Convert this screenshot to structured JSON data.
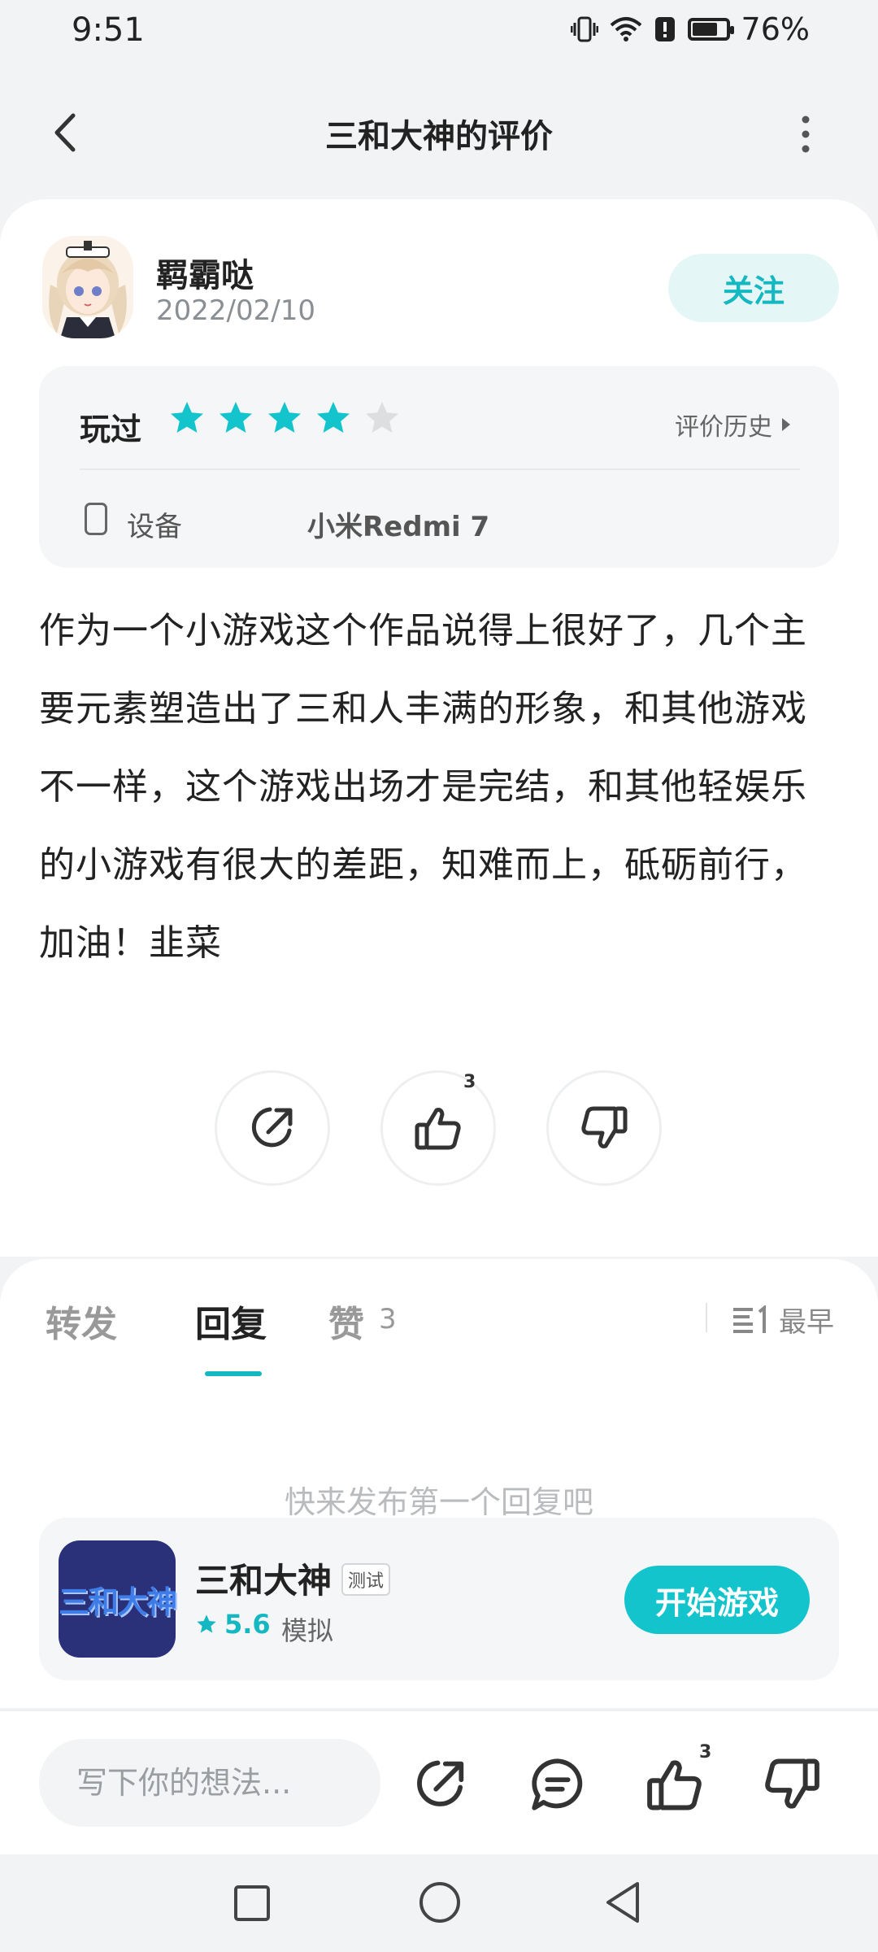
{
  "status_bar": {
    "time": "9:51",
    "battery": "76%",
    "battery_level": 0.76
  },
  "header": {
    "title": "三和大神的评价"
  },
  "review": {
    "user_name": "羁霸哒",
    "date": "2022/02/10",
    "follow_label": "关注",
    "played_label": "玩过",
    "rating": 4,
    "rating_max": 5,
    "history_label": "评价历史",
    "device_label": "设备",
    "device_value": "小米Redmi 7",
    "text": "作为一个小游戏这个作品说得上很好了，几个主要元素塑造出了三和人丰满的形象，和其他游戏不一样，这个游戏出场才是完结，和其他轻娱乐的小游戏有很大的差距，知难而上，砥砺前行，加油！韭菜",
    "like_count": "3"
  },
  "tabs": [
    {
      "label": "转发"
    },
    {
      "label": "回复",
      "active": true
    },
    {
      "label": "赞",
      "count": "3"
    }
  ],
  "sort_label": "最早",
  "empty_text": "快来发布第一个回复吧",
  "game": {
    "icon_text": "三和大神",
    "name": "三和大神",
    "badge": "测试",
    "score": "5.6",
    "genre": "模拟",
    "start_label": "开始游戏"
  },
  "bottom_bar": {
    "input_placeholder": "写下你的想法...",
    "like_count": "3"
  },
  "colors": {
    "accent": "#14c4cc",
    "star_empty": "#dcdee0",
    "game_icon_bg": "#2a3179"
  },
  "icons": [
    "back-icon",
    "more-icon",
    "star-icon",
    "device-icon",
    "share-icon",
    "thumbs-up-icon",
    "thumbs-down-icon",
    "sort-icon",
    "comment-icon",
    "recent-apps-icon",
    "home-icon",
    "nav-back-icon"
  ]
}
